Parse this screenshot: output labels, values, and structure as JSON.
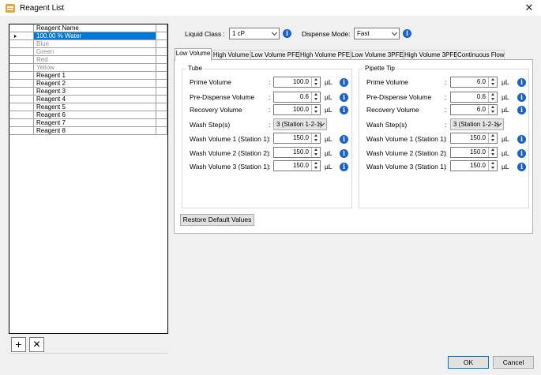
{
  "window": {
    "title": "Reagent List",
    "close_glyph": "✕"
  },
  "grid": {
    "header": "Reagent Name",
    "rows": [
      {
        "name": "100.00 % Water",
        "state": "selected"
      },
      {
        "name": "Blue",
        "state": "disabled"
      },
      {
        "name": "Green",
        "state": "disabled"
      },
      {
        "name": "Red",
        "state": "disabled"
      },
      {
        "name": "Yellow",
        "state": "disabled"
      },
      {
        "name": "Reagent 1",
        "state": "normal"
      },
      {
        "name": "Reagent 2",
        "state": "normal"
      },
      {
        "name": "Reagent 3",
        "state": "normal"
      },
      {
        "name": "Reagent 4",
        "state": "normal"
      },
      {
        "name": "Reagent 5",
        "state": "normal"
      },
      {
        "name": "Reagent 6",
        "state": "normal"
      },
      {
        "name": "Reagent 7",
        "state": "normal"
      },
      {
        "name": "Reagent 8",
        "state": "normal"
      }
    ],
    "add_glyph": "+",
    "remove_glyph": "✕"
  },
  "settings": {
    "liquid_class_label": "Liquid Class",
    "liquid_class_value": "1 cP",
    "dispense_mode_label": "Dispense Mode",
    "dispense_mode_value": "Fast",
    "colon": ":"
  },
  "tabs": [
    {
      "label": "Low Volume",
      "active": true
    },
    {
      "label": "High Volume"
    },
    {
      "label": "Low Volume PFE"
    },
    {
      "label": "High Volume PFE"
    },
    {
      "label": "Low Volume 3PFE"
    },
    {
      "label": "High Volume 3PFE"
    },
    {
      "label": "Continuous Flow"
    }
  ],
  "tube": {
    "title": "Tube",
    "fields": [
      {
        "label": "Prime Volume",
        "value": "100.0",
        "unit": "µL"
      },
      {
        "label": "Pre-Dispense Volume",
        "value": "0.6",
        "unit": "µL"
      },
      {
        "label": "Recovery Volume",
        "value": "100.0",
        "unit": "µL"
      },
      {
        "label": "Wash Step(s)",
        "value": "3 (Station 1-2-1)"
      },
      {
        "label": "Wash Volume 1 (Station 1)",
        "value": "150.0",
        "unit": "µL"
      },
      {
        "label": "Wash Volume 2 (Station 2)",
        "value": "150.0",
        "unit": "µL"
      },
      {
        "label": "Wash Volume 3 (Station 1)",
        "value": "150.0",
        "unit": "µL"
      }
    ]
  },
  "pipette_tip": {
    "title": "Pipette Tip",
    "fields": [
      {
        "label": "Prime Volume",
        "value": "6.0",
        "unit": "µL"
      },
      {
        "label": "Pre-Dispense Volume",
        "value": "0.6",
        "unit": "µL"
      },
      {
        "label": "Recovery Volume",
        "value": "6.0",
        "unit": "µL"
      },
      {
        "label": "Wash Step(s)",
        "value": "3 (Station 1-2-1)"
      },
      {
        "label": "Wash Volume 1 (Station 1)",
        "value": "150.0",
        "unit": "µL"
      },
      {
        "label": "Wash Volume 2 (Station 2)",
        "value": "150.0",
        "unit": "µL"
      },
      {
        "label": "Wash Volume 3 (Station 1)",
        "value": "150.0",
        "unit": "µL"
      }
    ]
  },
  "buttons": {
    "restore": "Restore Default Values",
    "ok": "OK",
    "cancel": "Cancel"
  },
  "info_glyph": "i"
}
